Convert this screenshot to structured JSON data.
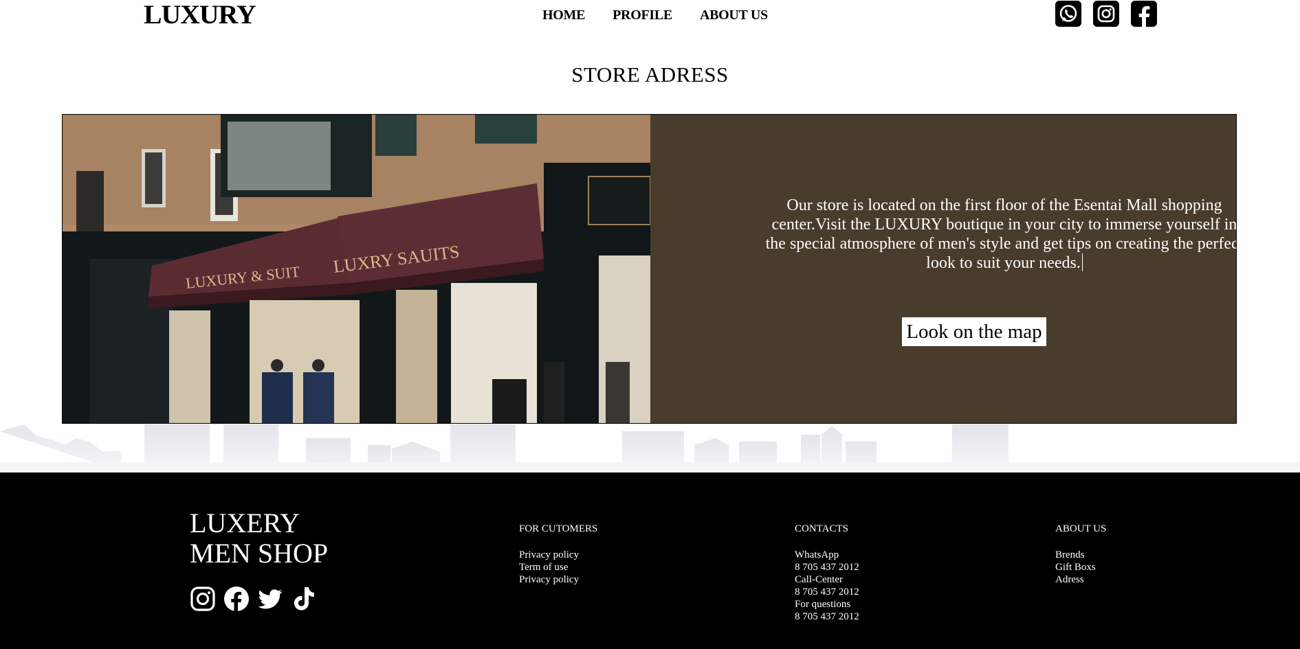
{
  "header": {
    "logo": "LUXURY",
    "nav": [
      "HOME",
      "PROFILE",
      "ABOUT US"
    ],
    "social_icons": [
      "whatsapp-icon",
      "instagram-icon",
      "facebook-icon"
    ]
  },
  "section": {
    "title": "STORE ADRESS",
    "description": "Our store is located on the first floor of the Esentai Mall shopping center.Visit the LUXURY boutique in your city to immerse yourself in the special atmosphere of men's style and get tips on creating the perfect look to suit your needs.",
    "map_button": "Look on the map",
    "photo_sign_left": "LUXURY & SUIT",
    "photo_sign_right": "LUXRY SAUITS",
    "panel_color": "#483c2c"
  },
  "footer": {
    "brand_line1": "LUXERY",
    "brand_line2": "MEN SHOP",
    "social_icons": [
      "instagram-icon",
      "facebook-icon",
      "twitter-icon",
      "tiktok-icon"
    ],
    "columns": [
      {
        "title": "FOR CUTOMERS",
        "items": [
          "Privacy policy",
          "Term of use",
          "Privacy policy"
        ]
      },
      {
        "title": "CONTACTS",
        "items": [
          "WhatsApp",
          "8 705 437 2012",
          "Call-Center",
          "8 705 437 2012",
          "For questions",
          "8 705 437 2012"
        ]
      },
      {
        "title": "ABOUT US",
        "items": [
          "Brends",
          "Gift Boxs",
          "Adress"
        ]
      }
    ]
  }
}
